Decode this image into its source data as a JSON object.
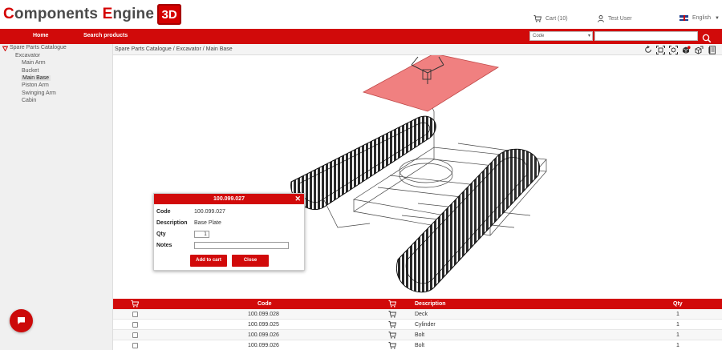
{
  "header": {
    "logo_c": "C",
    "logo_omponents": "omponents ",
    "logo_e": "E",
    "logo_ngine": "ngine",
    "logo_badge": "3D",
    "cart_label": "Cart (10)",
    "user_label": "Test User",
    "language": "English"
  },
  "nav": {
    "home": "Home",
    "search_products": "Search products",
    "search_type_selected": "Code",
    "search_value": ""
  },
  "sidebar": {
    "root": "Spare Parts Catalogue",
    "group": "Excavator",
    "items": [
      "Main Arm",
      "Bucket",
      "Main Base",
      "Piston Arm",
      "Swinging Arm",
      "Cabin"
    ],
    "selected": "Main Base"
  },
  "breadcrumb": "Spare Parts Catalogue / Excavator / Main Base",
  "toolbar_icons": [
    "reset-view-icon",
    "fit-view-icon",
    "focus-view-icon",
    "isolate-icon",
    "explode-icon",
    "parts-list-icon"
  ],
  "popup": {
    "title": "100.099.027",
    "code_label": "Code",
    "code_value": "100.099.027",
    "description_label": "Description",
    "description_value": "Base Plate",
    "qty_label": "Qty",
    "qty_value": "1",
    "notes_label": "Notes",
    "notes_value": "",
    "add_button": "Add to cart",
    "close_button": "Close"
  },
  "table": {
    "headers": {
      "code": "Code",
      "description": "Description",
      "qty": "Qty"
    },
    "rows": [
      {
        "code": "100.099.028",
        "description": "Deck",
        "qty": "1"
      },
      {
        "code": "100.099.025",
        "description": "Cylinder",
        "qty": "1"
      },
      {
        "code": "100.099.026",
        "description": "Bolt",
        "qty": "1"
      },
      {
        "code": "100.099.026",
        "description": "Bolt",
        "qty": "1"
      }
    ]
  },
  "colors": {
    "brand_red": "#d10a0a",
    "highlight_part": "#f08080"
  }
}
